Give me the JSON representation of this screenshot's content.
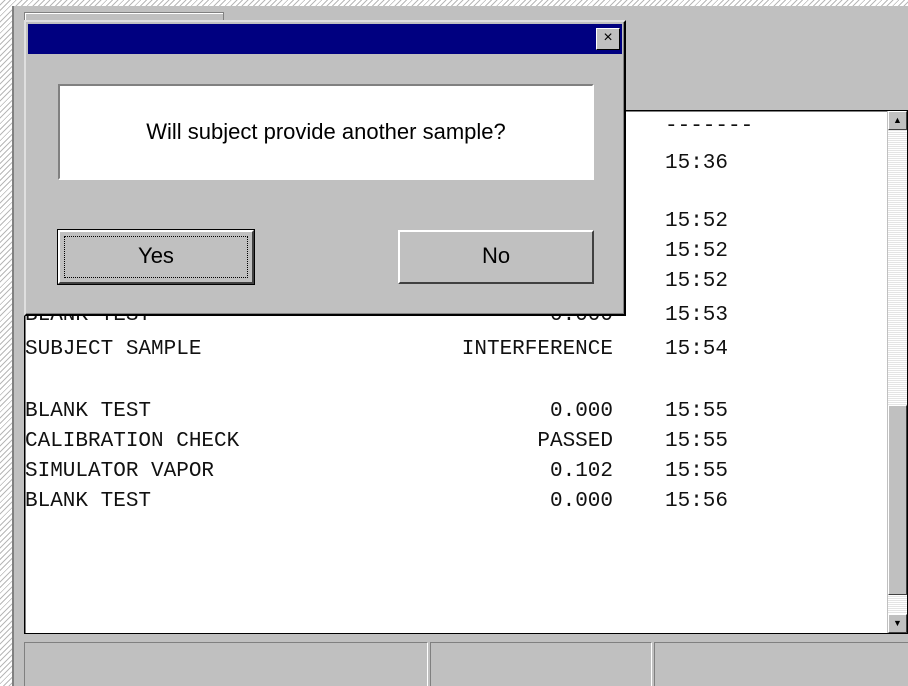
{
  "dialog": {
    "title": "",
    "close_glyph": "×",
    "message": "Will subject provide another sample?",
    "yes_label": "Yes",
    "no_label": "No"
  },
  "log": {
    "separator": "-------",
    "rows": [
      {
        "event": "",
        "result": "",
        "time": "15:36"
      },
      {
        "event": "",
        "result": "",
        "time": "15:52"
      },
      {
        "event": "",
        "result": "",
        "time": "15:52"
      },
      {
        "event": "",
        "result": "",
        "time": "15:52"
      },
      {
        "event": "BLANK TEST",
        "result": "0.000",
        "time": "15:53"
      },
      {
        "event": "SUBJECT SAMPLE",
        "result": "INTERFERENCE",
        "time": "15:54"
      },
      {
        "event": "BLANK TEST",
        "result": "0.000",
        "time": "15:55"
      },
      {
        "event": "CALIBRATION CHECK",
        "result": "PASSED",
        "time": "15:55"
      },
      {
        "event": "SIMULATOR VAPOR",
        "result": "0.102",
        "time": "15:55"
      },
      {
        "event": "BLANK TEST",
        "result": "0.000",
        "time": "15:56"
      }
    ]
  },
  "scrollbar": {
    "up_glyph": "▲",
    "down_glyph": "▼"
  },
  "statusbar": {
    "pane1": "",
    "pane2": "",
    "pane3": ""
  },
  "colors": {
    "titlebar": "#000080",
    "face": "#c0c0c0"
  }
}
